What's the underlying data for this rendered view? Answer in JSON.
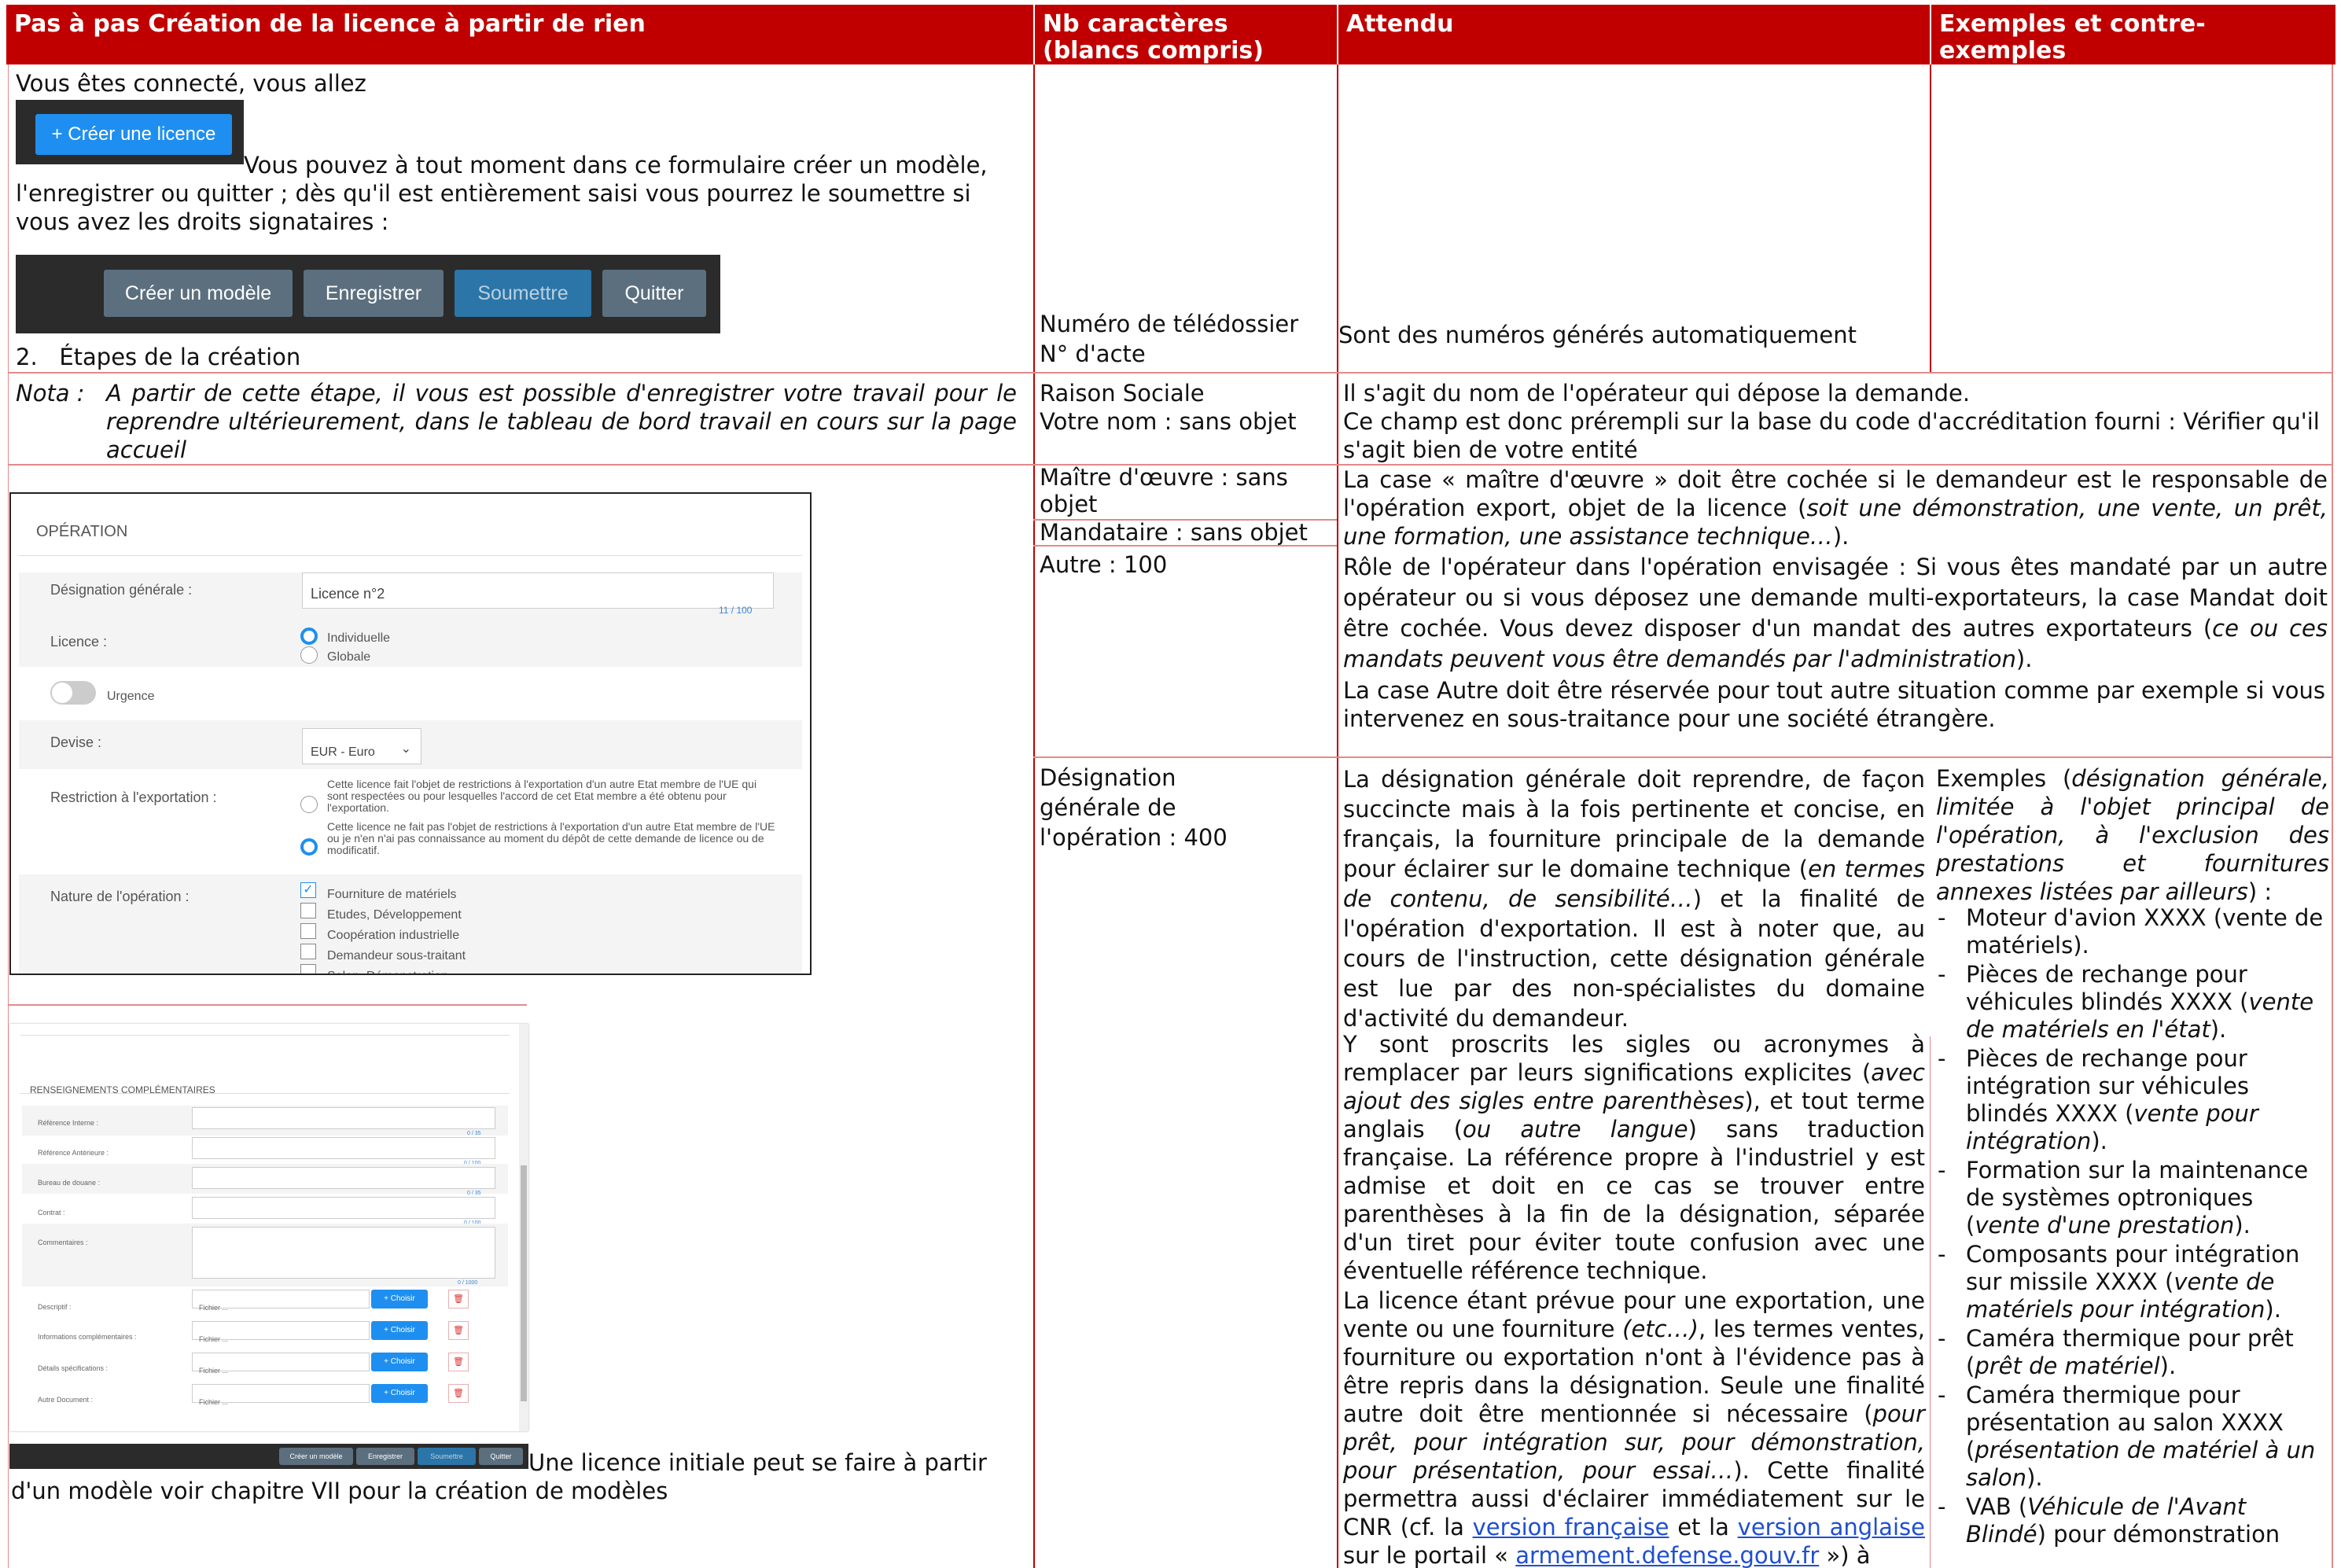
{
  "header": {
    "col1": "Pas à pas Création de la licence à partir de rien",
    "col2": "Nb caractères (blancs compris)",
    "col3": "Attendu",
    "col4": "Exemples et contre-exemples"
  },
  "row1": {
    "intro": "Vous êtes connecté, vous allez",
    "create_button": "Créer une licence",
    "para": "Vous pouvez à tout moment dans ce formulaire créer un modèle, l'enregistrer ou quitter ; dès qu'il est entièrement saisi vous pourrez le soumettre si vous avez les droits signataires :",
    "toolbar": [
      "Créer un modèle",
      "Enregistrer",
      "Soumettre",
      "Quitter"
    ],
    "step": "2.   Étapes de la création",
    "nb_line1": "Numéro de télédossier",
    "nb_line2": "N° d'acte",
    "attendu": "Sont des numéros générés automatiquement"
  },
  "row2": {
    "nota_label": "Nota :",
    "nota_text": "A partir de cette étape, il vous est possible d'enregistrer votre travail pour le reprendre ultérieurement, dans le tableau de bord travail en cours sur la page accueil",
    "nb_line1": "Raison Sociale",
    "nb_line2": "Votre nom : sans objet",
    "att_line1": "Il s'agit du nom de l'opérateur qui dépose la demande.",
    "att_line2": "Ce champ est donc prérempli sur la base du code d'accréditation fourni : Vérifier qu'il s'agit bien de votre entité"
  },
  "row3": {
    "nb_moe": "Maître d'œuvre : sans objet",
    "nb_mand": "Mandataire : sans objet",
    "nb_autre": "Autre : 100",
    "att_p1a": "La case « maître d'œuvre » doit être cochée si le demandeur est le responsable de l'opération export, objet de la licence (",
    "att_p1b": "soit une démonstration, une vente, un prêt, une formation, une assistance technique…",
    "att_p1c": ").",
    "att_p2a": "Rôle de l'opérateur dans l'opération envisagée : Si vous êtes mandaté par un autre opérateur ou si vous déposez une demande multi-exportateurs, la case Mandat doit être cochée. Vous devez disposer d'un mandat des autres exportateurs (",
    "att_p2b": "ce ou ces mandats peuvent vous être demandés par l'administration",
    "att_p2c": ").",
    "att_p3": "La case Autre doit être réservée pour tout autre situation comme par exemple si vous intervenez en sous-traitance pour une société étrangère."
  },
  "operation_form": {
    "title": "OPÉRATION",
    "designation_label": "Désignation générale :",
    "designation_value": "Licence n°2",
    "designation_counter": "11 / 100",
    "licence_label": "Licence :",
    "licence_options": [
      "Individuelle",
      "Globale"
    ],
    "urgence_label": "Urgence",
    "devise_label": "Devise :",
    "devise_value": "EUR - Euro",
    "restriction_label": "Restriction à l'exportation :",
    "restriction_opt1": "Cette licence fait l'objet de restrictions à l'exportation d'un autre Etat membre de l'UE qui sont respectées ou pour lesquelles l'accord de cet Etat membre a été obtenu pour l'exportation.",
    "restriction_opt2": "Cette licence ne fait pas l'objet de restrictions à l'exportation d'un autre Etat membre de l'UE ou je n'en n'ai pas connaissance au moment du dépôt de cette demande de licence ou de modificatif.",
    "nature_label": "Nature de l'opération :",
    "nature_options": [
      "Fourniture de matériels",
      "Etudes, Développement",
      "Coopération industrielle",
      "Demandeur sous-traitant",
      "Salon, Démonstration"
    ]
  },
  "renseignements_form": {
    "title": "RENSEIGNEMENTS COMPLÉMENTAIRES",
    "fields": [
      {
        "label": "Référence Interne :",
        "counter": "0 / 35"
      },
      {
        "label": "Référence Antérieure :",
        "counter": "0 / 100"
      },
      {
        "label": "Bureau de douane :",
        "counter": "0 / 35"
      },
      {
        "label": "Contrat :",
        "counter": "0 / 100"
      }
    ],
    "commentaires_label": "Commentaires :",
    "commentaires_counter": "0 / 1000",
    "files": [
      {
        "label": "Descriptif :",
        "placeholder": "Fichier ...",
        "button": "+ Choisir"
      },
      {
        "label": "Informations complémentaires :",
        "placeholder": "Fichier ...",
        "button": "+ Choisir"
      },
      {
        "label": "Détails spécifications :",
        "placeholder": "Fichier ...",
        "button": "+ Choisir"
      },
      {
        "label": "Autre Document :",
        "placeholder": "Fichier ...",
        "button": "+ Choisir"
      }
    ],
    "toolbar": [
      "Créer un modèle",
      "Enregistrer",
      "Soumettre",
      "Quitter"
    ]
  },
  "modele_text": "Une licence initiale peut se faire à partir d'un modèle voir chapitre VII pour la création de modèles",
  "row4": {
    "nb_text": "Désignation générale de l'opération : 400",
    "att_p1a": "La désignation générale doit reprendre, de façon succincte mais à la fois pertinente et concise, en français, la fourniture principale de la demande pour éclairer sur le domaine technique (",
    "att_p1b": "en termes de contenu, de sensibilité…",
    "att_p1c": ") et la finalité de l'opération d'exportation. Il est à noter que, au cours de l'instruction, cette désignation générale est lue par des non-spécialistes du domaine d'activité du demandeur.",
    "att_p2a": "Y sont proscrits les sigles ou acronymes à remplacer par leurs significations explicites (",
    "att_p2b": "avec ajout des sigles entre parenthèses",
    "att_p2c": "), et tout terme anglais (",
    "att_p2d": "ou autre langue",
    "att_p2e": ") sans traduction française. La référence propre à l'industriel y est admise et doit en ce cas se trouver entre parenthèses à la fin de la désignation, séparée d'un tiret pour éviter toute confusion avec une éventuelle référence technique.",
    "att_p3a": "La licence étant prévue pour une exportation, une vente ou une fourniture ",
    "att_p3b": "(etc…)",
    "att_p3c": ", les termes ventes, fourniture ou exportation n'ont à l'évidence pas à être repris dans la désignation. Seule une finalité autre doit être mentionnée si nécessaire (",
    "att_p3d": "pour prêt, pour intégration sur, pour démonstration, pour présentation, pour essai…",
    "att_p3e": "). Cette finalité permettra aussi d'éclairer immédiatement sur le CNR (cf. la ",
    "link1": "version française",
    "att_p3f": " et la ",
    "link2": "version anglaise",
    "att_p3g": " sur le portail « ",
    "link3": "armement.defense.gouv.fr",
    "att_p3h": " ») à",
    "ex_intro_a": "Exemples (",
    "ex_intro_b": "désignation générale, limitée à l'objet principal de l'opération, à l'exclusion des prestations et fournitures annexes listées par ailleurs",
    "ex_intro_c": ") :",
    "examples": [
      {
        "text": "Moteur d'avion XXXX (vente de matériels).",
        "it": ""
      },
      {
        "text": "Pièces de rechange pour véhicules blindés XXXX (",
        "it": "vente de matériels en l'état",
        "end": ")."
      },
      {
        "text": "Pièces de rechange pour intégration sur véhicules blindés XXXX (",
        "it": "vente pour intégration",
        "end": ")."
      },
      {
        "text": "Formation sur la maintenance de systèmes optroniques (",
        "it": "vente d'une prestation",
        "end": ")."
      },
      {
        "text": "Composants pour intégration sur missile XXXX (",
        "it": "vente de matériels pour intégration",
        "end": ")."
      },
      {
        "text": "Caméra thermique pour prêt (",
        "it": "prêt de matériel",
        "end": ")."
      },
      {
        "text": "Caméra thermique pour présentation au salon XXXX (",
        "it": "présentation de matériel à un salon",
        "end": ")."
      },
      {
        "text": "VAB (",
        "it": "Véhicule de l'Avant Blindé",
        "end": ") pour démonstration"
      }
    ]
  }
}
